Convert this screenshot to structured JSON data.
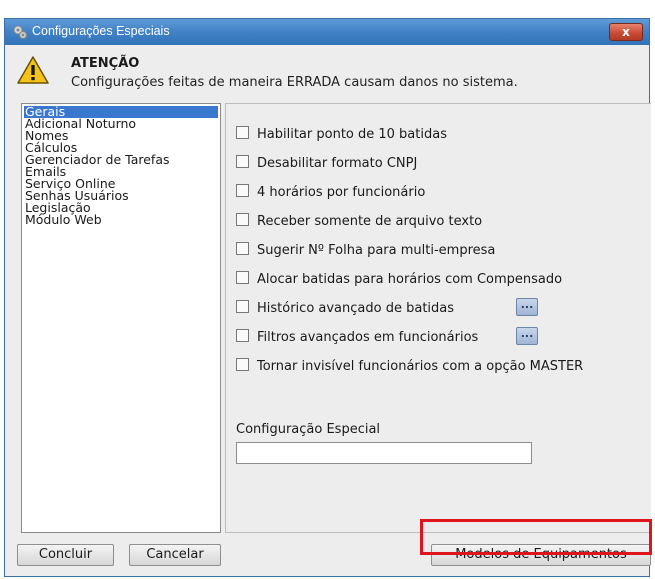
{
  "window": {
    "title": "Configurações Especiais",
    "close_label": "x"
  },
  "warning": {
    "title": "ATENÇÃO",
    "message": "Configurações feitas de maneira ERRADA causam danos no sistema."
  },
  "sidebar": {
    "items": [
      {
        "label": "Gerais",
        "selected": true
      },
      {
        "label": "Adicional Noturno"
      },
      {
        "label": "Nomes"
      },
      {
        "label": "Cálculos"
      },
      {
        "label": "Gerenciador de Tarefas"
      },
      {
        "label": "Emails"
      },
      {
        "label": "Serviço Online"
      },
      {
        "label": "Senhas Usuários"
      },
      {
        "label": "Legislação"
      },
      {
        "label": "Módulo Web"
      }
    ]
  },
  "options": [
    {
      "label": "Habilitar ponto de 10 batidas",
      "checked": false
    },
    {
      "label": "Desabilitar formato CNPJ",
      "checked": false
    },
    {
      "label": "4 horários por funcionário",
      "checked": false
    },
    {
      "label": "Receber somente de arquivo texto",
      "checked": false
    },
    {
      "label": "Sugerir Nº Folha para multi-empresa",
      "checked": false
    },
    {
      "label": "Alocar batidas para horários com Compensado",
      "checked": false
    },
    {
      "label": "Histórico avançado de batidas",
      "checked": false,
      "more_label": "..."
    },
    {
      "label": "Filtros avançados em funcionários",
      "checked": false,
      "more_label": "..."
    },
    {
      "label": "Tornar invisível funcionários com a opção MASTER",
      "checked": false
    }
  ],
  "special": {
    "label": "Configuração Especial",
    "value": ""
  },
  "buttons": {
    "concluir": "Concluir",
    "cancelar": "Cancelar",
    "modelos": "Modelos de Equipamentos"
  },
  "colors": {
    "titlebar": "#3f7fc4",
    "selection": "#3a78d0",
    "highlight": "#e0141c",
    "close": "#c74a33"
  }
}
